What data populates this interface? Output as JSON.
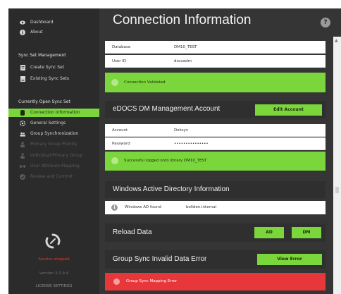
{
  "sidebar": {
    "top": [
      {
        "label": "Dashboard",
        "icon": "eye-icon"
      },
      {
        "label": "About",
        "icon": "info-icon"
      }
    ],
    "section1_title": "Sync Set Management",
    "section1": [
      {
        "label": "Create Sync Set",
        "icon": "document-plus-icon"
      },
      {
        "label": "Existing Sync Sets",
        "icon": "document-icon"
      }
    ],
    "section2_title": "Currently Open Sync Set",
    "section2": [
      {
        "label": "Connection Information",
        "icon": "database-icon",
        "state": "active"
      },
      {
        "label": "General Settings",
        "icon": "gear-icon",
        "state": "normal"
      },
      {
        "label": "Group Synchronization",
        "icon": "users-icon",
        "state": "normal"
      },
      {
        "label": "Primary Group Priority",
        "icon": "priority-icon",
        "state": "disabled"
      },
      {
        "label": "Individual Primary Group",
        "icon": "user-icon",
        "state": "disabled"
      },
      {
        "label": "User Attribute Mapping",
        "icon": "mapping-icon",
        "state": "disabled"
      },
      {
        "label": "Review and Commit",
        "icon": "check-icon",
        "state": "disabled"
      }
    ],
    "footer": {
      "service_status": "Service stopped",
      "version": "Version 3.0.9.4",
      "license": "LICENSE SETTINGS"
    }
  },
  "main": {
    "title": "Connection Information",
    "help_label": "?",
    "database": {
      "rows": [
        {
          "key": "Database",
          "value": "DM10_TEST"
        },
        {
          "key": "User ID",
          "value": "docsadm"
        }
      ],
      "status": "Connection Validated"
    },
    "edocs": {
      "title": "eDOCS DM Management Account",
      "button": "Edit Account",
      "rows": [
        {
          "key": "Account",
          "value": "Doksys"
        },
        {
          "key": "Password",
          "value": "•••••••••••••••"
        }
      ],
      "status": "Successful logged onto library DM10_TEST"
    },
    "ad": {
      "title": "Windows Active Directory Information",
      "label": "Windows AD found",
      "value": "boliden.internal"
    },
    "reload": {
      "title": "Reload Data",
      "button_ad": "AD",
      "button_dm": "DM"
    },
    "group_error": {
      "title": "Group Sync Invalid Data Error",
      "button": "View Error",
      "message": "Group Sync Mapping Error"
    }
  },
  "colors": {
    "accent": "#7ad63a",
    "error": "#e8373a",
    "sidebar_bg": "#2b2b2b",
    "main_bg": "#353535"
  }
}
